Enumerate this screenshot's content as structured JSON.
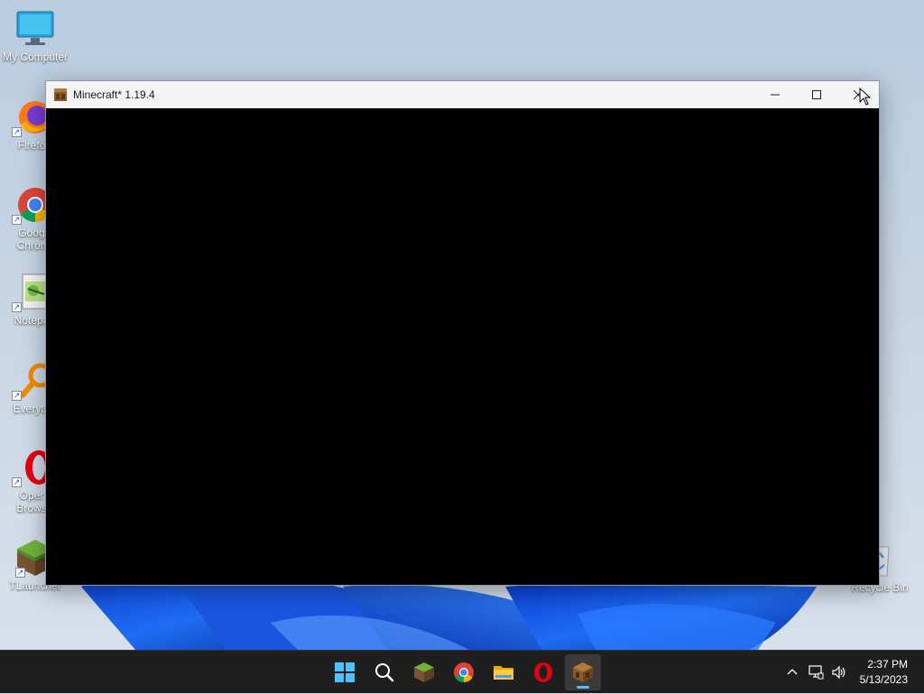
{
  "desktop": {
    "icons": [
      {
        "label": "My Computer",
        "icon": "monitor-icon"
      },
      {
        "label": "Firefo",
        "icon": "firefox-icon"
      },
      {
        "label": "Goog",
        "label2": "Chron",
        "icon": "chrome-icon"
      },
      {
        "label": "Notepa",
        "icon": "notepad-icon"
      },
      {
        "label": "Everyth",
        "icon": "everything-icon"
      },
      {
        "label": "Oper",
        "label2": "Brows",
        "icon": "opera-icon"
      },
      {
        "label": "TLauncher",
        "icon": "minecraft-grass-icon"
      },
      {
        "label": "Recycle Bin",
        "icon": "recycle-bin-icon"
      }
    ]
  },
  "window": {
    "title": "Minecraft* 1.19.4",
    "icon": "crafting-table-icon",
    "controls": {
      "minimize": "minimize-icon",
      "maximize": "maximize-icon",
      "close": "close-icon"
    }
  },
  "taskbar": {
    "apps": [
      {
        "name": "start",
        "icon": "windows-logo-icon",
        "active": false
      },
      {
        "name": "search",
        "icon": "search-icon",
        "active": false
      },
      {
        "name": "tlauncher",
        "icon": "minecraft-grass-icon",
        "active": false
      },
      {
        "name": "chrome",
        "icon": "chrome-icon",
        "active": false
      },
      {
        "name": "file-explorer",
        "icon": "folder-icon",
        "active": false
      },
      {
        "name": "opera",
        "icon": "opera-icon",
        "active": false
      },
      {
        "name": "minecraft",
        "icon": "crafting-table-icon",
        "active": true
      }
    ],
    "tray": {
      "time": "2:37 PM",
      "date": "5/13/2023"
    }
  },
  "colors": {
    "taskbar_bg": "#1f1f1f",
    "accent": "#4cc2ff",
    "titlebar_bg": "#f3f3f3"
  }
}
